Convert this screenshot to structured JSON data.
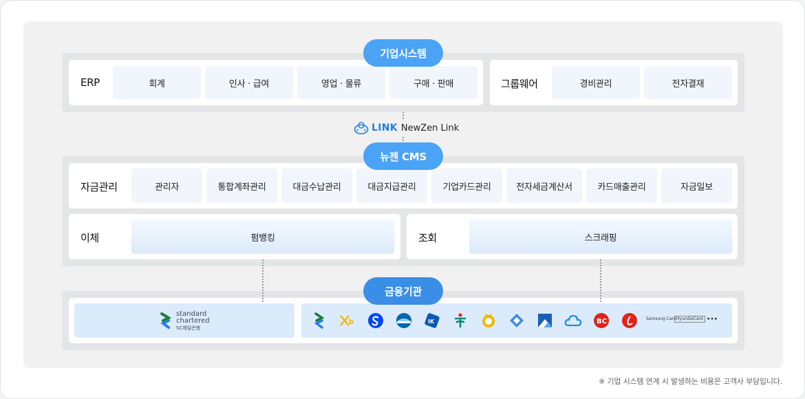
{
  "enterprise": {
    "title": "기업시스템",
    "erp_label": "ERP",
    "erp_items": [
      "회계",
      "인사 · 급여",
      "영업 · 물류",
      "구매 · 판매"
    ],
    "groupware_label": "그룹웨어",
    "groupware_items": [
      "경비관리",
      "전자결재"
    ]
  },
  "link": {
    "word": "LINK",
    "name": "NewZen Link"
  },
  "cms": {
    "title": "뉴젠 CMS",
    "fund_label": "자금관리",
    "fund_items": [
      "관리자",
      "통합계좌관리",
      "대금수납관리",
      "대금지급관리",
      "기업카드관리",
      "전자세금계산서",
      "카드매출관리",
      "자금일보"
    ],
    "transfer_label": "이체",
    "transfer_item": "펌뱅킹",
    "inquiry_label": "조회",
    "inquiry_item": "스크래핑"
  },
  "finance": {
    "title": "금융기관",
    "main_bank": {
      "line1": "standard",
      "line2": "chartered",
      "line3": "SC제일은행"
    },
    "bank_icons": [
      "standard-chartered-icon",
      "kb-icon",
      "shinhan-icon",
      "woori-icon",
      "ibk-icon",
      "hana-icon",
      "nonghyup-icon",
      "citi-icon",
      "kdb-icon",
      "kakao-icon",
      "bc-card-icon",
      "lotte-card-icon"
    ],
    "card_brands": [
      "Samsung Card",
      "HyundaiCard"
    ],
    "more": "···"
  },
  "footnote": "※ 기업 시스템 연계 시 발생하는 비용은 고객사 부담입니다.",
  "colors": {
    "pill": "#4aa3f5",
    "pill_finance": "#3b8ee8",
    "accent": "#2a7de1"
  }
}
